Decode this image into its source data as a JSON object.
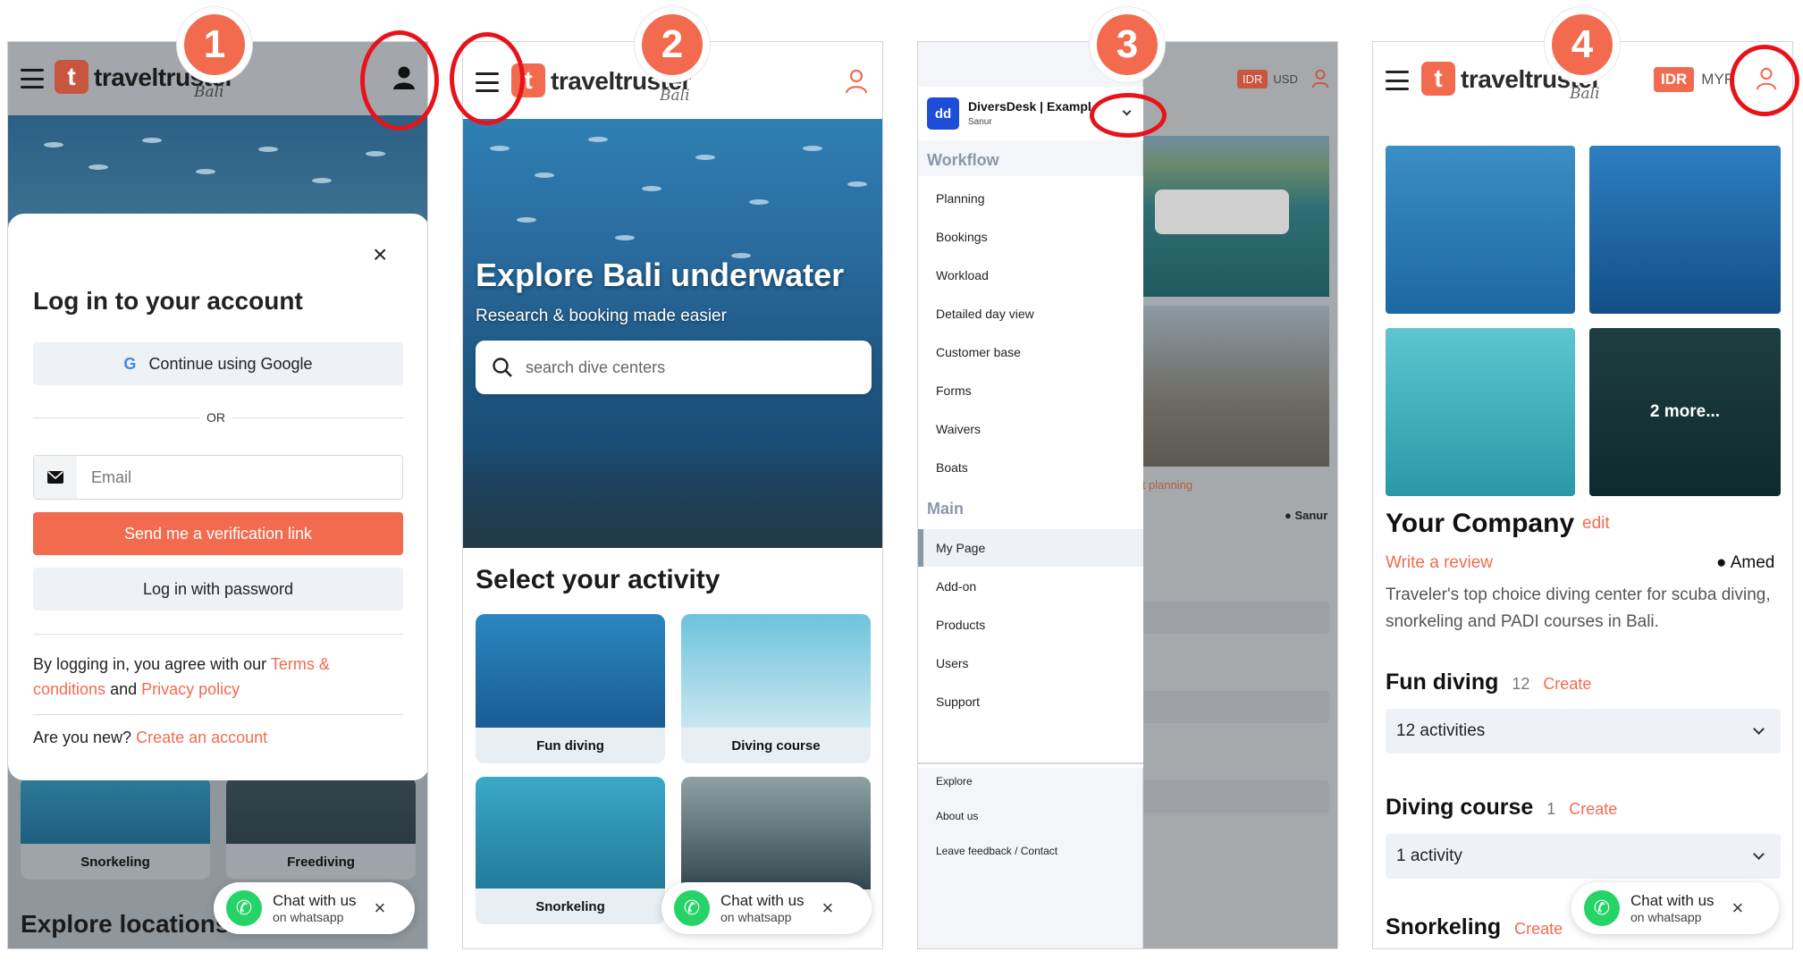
{
  "steps": [
    "1",
    "2",
    "3",
    "4"
  ],
  "brand": {
    "name": "traveltruster",
    "region": "Bali",
    "logo_glyph": "t",
    "accent": "#f26b4f"
  },
  "panel1": {
    "modal_title": "Log in to your account",
    "google_button": "Continue using Google",
    "or_label": "OR",
    "email_placeholder": "Email",
    "verify_button": "Send me a verification link",
    "password_button": "Log in with password",
    "agree_prefix": "By logging in, you agree with our ",
    "terms_link": "Terms & conditions",
    "agree_and": " and ",
    "privacy_link": "Privacy policy",
    "new_prefix": "Are you new? ",
    "create_link": "Create an account",
    "card_snorkeling": "Snorkeling",
    "card_freediving": "Freediving",
    "explore_heading": "Explore locations"
  },
  "whatsapp": {
    "title": "Chat with us",
    "subtitle": "on whatsapp"
  },
  "panel2": {
    "hero_title": "Explore Bali underwater",
    "hero_subtitle": "Research & booking made easier",
    "search_placeholder": "search dive centers",
    "section_title": "Select your activity",
    "activities": [
      "Fun diving",
      "Diving course",
      "Snorkeling"
    ]
  },
  "panel3": {
    "currency": [
      "IDR",
      "USD"
    ],
    "account_name": "DiversDesk | Exampl",
    "account_location": "Sanur",
    "workflow_heading": "Workflow",
    "workflow_items": [
      "Planning",
      "Bookings",
      "Workload",
      "Detailed day view",
      "Customer base",
      "Forms",
      "Waivers",
      "Boats"
    ],
    "main_heading": "Main",
    "main_items": [
      "My Page",
      "Add-on",
      "Products",
      "Users",
      "Support"
    ],
    "footer_items": [
      "Explore",
      "About us",
      "Leave feedback / Contact"
    ],
    "bg_links": "lit  planning",
    "bg_location": "Sanur"
  },
  "panel4": {
    "currency": [
      "IDR",
      "MYR"
    ],
    "more_label": "2 more...",
    "company_name": "Your Company",
    "edit_link": "edit",
    "review_link": "Write a review",
    "location": "Amed",
    "description": "Traveler's top choice diving center for scuba diving, snorkeling and PADI courses in Bali.",
    "sections": [
      {
        "title": "Fun diving",
        "count": "12",
        "create": "Create",
        "select_value": "12 activities"
      },
      {
        "title": "Diving course",
        "count": "1",
        "create": "Create",
        "select_value": "1 activity"
      },
      {
        "title": "Snorkeling",
        "count": "",
        "create": "Create",
        "select_value": ""
      }
    ]
  },
  "icons": {
    "close": "×",
    "search": "search-icon",
    "user": "user-icon",
    "mail": "mail-icon",
    "pin": "map-pin-icon",
    "google": "G"
  }
}
